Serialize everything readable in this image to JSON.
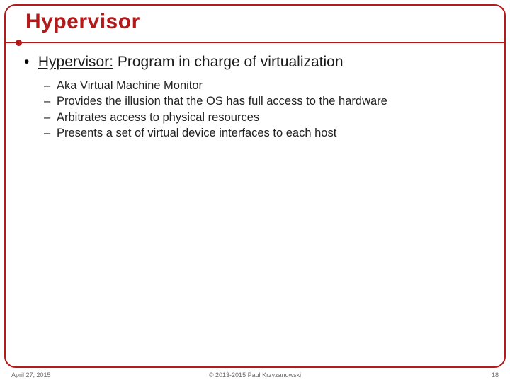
{
  "title": "Hypervisor",
  "main_bullet": {
    "symbol": "•",
    "term": "Hypervisor:",
    "rest": " Program in charge of virtualization"
  },
  "sub_bullets": {
    "symbol": "–",
    "items": [
      "Aka Virtual Machine Monitor",
      "Provides the illusion that the OS has full access to the hardware",
      "Arbitrates access to physical resources",
      "Presents a set of virtual device interfaces to each host"
    ]
  },
  "footer": {
    "date": "April 27, 2015",
    "copyright": "© 2013-2015 Paul Krzyzanowski",
    "page": "18"
  },
  "colors": {
    "accent": "#b31b1b"
  }
}
